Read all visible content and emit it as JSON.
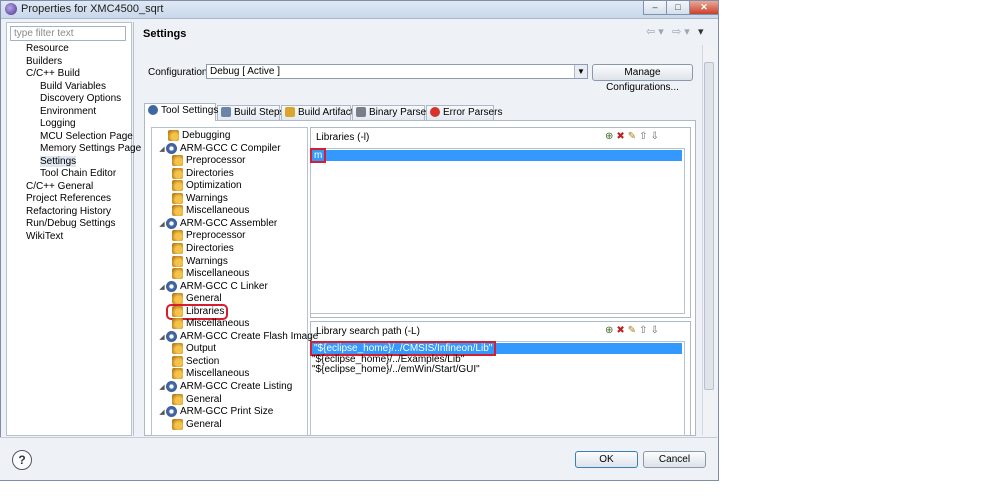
{
  "window": {
    "title": "Properties for XMC4500_sqrt"
  },
  "filter": {
    "placeholder": "type filter text"
  },
  "nav": [
    {
      "label": "Resource",
      "level": 0
    },
    {
      "label": "Builders",
      "level": 0
    },
    {
      "label": "C/C++ Build",
      "level": 0
    },
    {
      "label": "Build Variables",
      "level": 1
    },
    {
      "label": "Discovery Options",
      "level": 1
    },
    {
      "label": "Environment",
      "level": 1
    },
    {
      "label": "Logging",
      "level": 1
    },
    {
      "label": "MCU Selection Page",
      "level": 1
    },
    {
      "label": "Memory Settings Page",
      "level": 1
    },
    {
      "label": "Settings",
      "level": 1,
      "selected": true
    },
    {
      "label": "Tool Chain Editor",
      "level": 1
    },
    {
      "label": "C/C++ General",
      "level": 0
    },
    {
      "label": "Project References",
      "level": 0
    },
    {
      "label": "Refactoring History",
      "level": 0
    },
    {
      "label": "Run/Debug Settings",
      "level": 0
    },
    {
      "label": "WikiText",
      "level": 0
    }
  ],
  "page": {
    "title": "Settings"
  },
  "config": {
    "label": "Configuration:",
    "value": "Debug  [ Active ]",
    "manage_label": "Manage Configurations..."
  },
  "tabs": [
    {
      "label": "Tool Settings",
      "active": true,
      "icon": "gear-icon"
    },
    {
      "label": "Build Steps",
      "icon": "wrench-icon"
    },
    {
      "label": "Build Artifact",
      "icon": "artifact-icon"
    },
    {
      "label": "Binary Parsers",
      "icon": "binary-icon"
    },
    {
      "label": "Error Parsers",
      "icon": "error-icon"
    }
  ],
  "tool_tree": [
    {
      "label": "Debugging",
      "kind": "doc",
      "level": 1
    },
    {
      "label": "ARM-GCC C Compiler",
      "kind": "gear",
      "level": 0
    },
    {
      "label": "Preprocessor",
      "kind": "doc",
      "level": 1
    },
    {
      "label": "Directories",
      "kind": "doc",
      "level": 1
    },
    {
      "label": "Optimization",
      "kind": "doc",
      "level": 1
    },
    {
      "label": "Warnings",
      "kind": "doc",
      "level": 1
    },
    {
      "label": "Miscellaneous",
      "kind": "doc",
      "level": 1
    },
    {
      "label": "ARM-GCC Assembler",
      "kind": "gear",
      "level": 0
    },
    {
      "label": "Preprocessor",
      "kind": "doc",
      "level": 1
    },
    {
      "label": "Directories",
      "kind": "doc",
      "level": 1
    },
    {
      "label": "Warnings",
      "kind": "doc",
      "level": 1
    },
    {
      "label": "Miscellaneous",
      "kind": "doc",
      "level": 1
    },
    {
      "label": "ARM-GCC C Linker",
      "kind": "gear",
      "level": 0
    },
    {
      "label": "General",
      "kind": "doc",
      "level": 1
    },
    {
      "label": "Libraries",
      "kind": "doc",
      "level": 1,
      "highlight": true
    },
    {
      "label": "Miscellaneous",
      "kind": "doc",
      "level": 1
    },
    {
      "label": "ARM-GCC Create Flash Image",
      "kind": "gear",
      "level": 0
    },
    {
      "label": "Output",
      "kind": "doc",
      "level": 1
    },
    {
      "label": "Section",
      "kind": "doc",
      "level": 1
    },
    {
      "label": "Miscellaneous",
      "kind": "doc",
      "level": 1
    },
    {
      "label": "ARM-GCC Create Listing",
      "kind": "gear",
      "level": 0
    },
    {
      "label": "General",
      "kind": "doc",
      "level": 1
    },
    {
      "label": "ARM-GCC Print Size",
      "kind": "gear",
      "level": 0
    },
    {
      "label": "General",
      "kind": "doc",
      "level": 1
    }
  ],
  "libraries": {
    "label": "Libraries (-l)",
    "items": [
      "m"
    ]
  },
  "libpaths": {
    "label": "Library search path (-L)",
    "items": [
      "\"${eclipse_home}/../CMSIS/Infineon/Lib\"",
      "\"${eclipse_home}/../Examples/Lib\"",
      "\"${eclipse_home}/../emWin/Start/GUI\""
    ]
  },
  "buttons": {
    "ok": "OK",
    "cancel": "Cancel",
    "help": "?"
  },
  "icons": {
    "toolbar": [
      "add-icon",
      "delete-icon",
      "edit-icon",
      "move-up-icon",
      "move-down-icon"
    ]
  }
}
